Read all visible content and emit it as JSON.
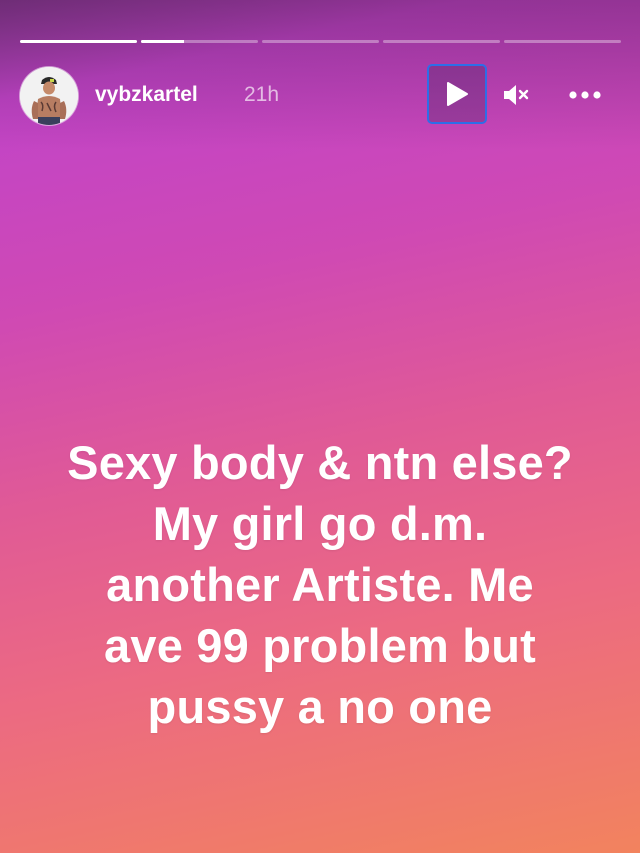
{
  "story": {
    "username": "vybzkartel",
    "timestamp": "21h",
    "progress": [
      1.0,
      0.37,
      0,
      0,
      0
    ],
    "caption_lines": [
      "Sexy body & ntn else?",
      "My girl go d.m.",
      "another Artiste. Me",
      "ave 99 problem but",
      "pussy a no one"
    ]
  },
  "controls": {
    "play_icon": "play-icon",
    "mute_icon": "speaker-muted-icon",
    "more_icon": "more-horizontal-icon"
  },
  "colors": {
    "gradient_top": "#c144c8",
    "gradient_bottom": "#f2835e",
    "focus_ring": "#2d6ee8",
    "text": "#ffffff"
  }
}
